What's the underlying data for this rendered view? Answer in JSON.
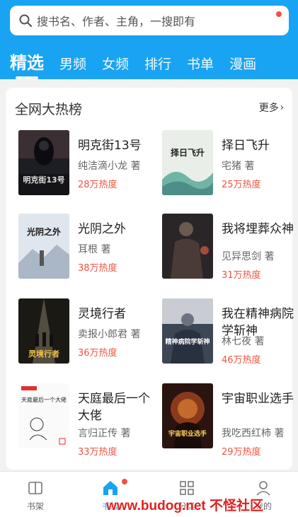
{
  "search": {
    "placeholder": "搜书名、作者、主角，一搜即有"
  },
  "tabs": [
    "精选",
    "男频",
    "女频",
    "排行",
    "书单",
    "漫画"
  ],
  "section": {
    "title": "全网大热榜",
    "more": "更多"
  },
  "books": [
    {
      "title": "明克街13号",
      "author": "纯洁滴小龙 著",
      "heat": "28万热度",
      "cover_text": "明克街13号"
    },
    {
      "title": "择日飞升",
      "author": "宅猪 著",
      "heat": "25万热度",
      "cover_text": "择日飞升"
    },
    {
      "title": "光阴之外",
      "author": "耳根 著",
      "heat": "38万热度",
      "cover_text": "光阴之外"
    },
    {
      "title": "我将埋葬众神",
      "author": "见异思剑 著",
      "heat": "31万热度",
      "cover_text": ""
    },
    {
      "title": "灵境行者",
      "author": "卖报小郎君 著",
      "heat": "36万热度",
      "cover_text": "灵境行者"
    },
    {
      "title": "我在精神病院学斩神",
      "author": "林七夜 著",
      "heat": "46万热度",
      "cover_text": "精神病院学斩神"
    },
    {
      "title": "天庭最后一个大佬",
      "author": "言归正传 著",
      "heat": "33万热度",
      "cover_text": "天庭最后一个大佬"
    },
    {
      "title": "宇宙职业选手",
      "author": "我吃西红柿 著",
      "heat": "29万热度",
      "cover_text": "宇宙职业选手"
    }
  ],
  "bottom_nav": [
    {
      "label": "书架",
      "icon": "bookshelf-icon"
    },
    {
      "label": "书城",
      "icon": "home-icon"
    },
    {
      "label": "分类",
      "icon": "category-icon"
    },
    {
      "label": "我的",
      "icon": "profile-icon"
    }
  ],
  "watermark": "www.budog.net 不怪社区",
  "colors": {
    "accent": "#19a3f3",
    "heat": "#f0523f"
  }
}
